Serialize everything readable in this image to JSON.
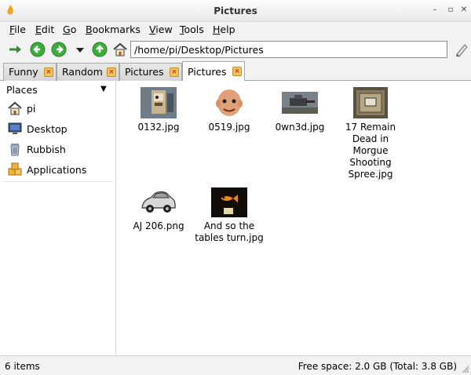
{
  "window": {
    "title": "Pictures"
  },
  "menu": [
    "File",
    "Edit",
    "Go",
    "Bookmarks",
    "View",
    "Tools",
    "Help"
  ],
  "toolbar": {
    "address": "/home/pi/Desktop/Pictures"
  },
  "tabs": [
    {
      "label": "Funny",
      "active": false
    },
    {
      "label": "Random",
      "active": false
    },
    {
      "label": "Pictures",
      "active": false
    },
    {
      "label": "Pictures",
      "active": true
    }
  ],
  "sidebar": {
    "header": "Places",
    "items": [
      {
        "label": "pi",
        "icon": "home-icon"
      },
      {
        "label": "Desktop",
        "icon": "desktop-icon"
      },
      {
        "label": "Rubbish",
        "icon": "trash-icon"
      },
      {
        "label": "Applications",
        "icon": "applications-icon"
      }
    ]
  },
  "files": [
    {
      "name": "0132.jpg",
      "thumb": "robot-photo"
    },
    {
      "name": "0519.jpg",
      "thumb": "bald-face-photo"
    },
    {
      "name": "0wn3d.jpg",
      "thumb": "tank-photo"
    },
    {
      "name": "17 Remain Dead in Morgue Shooting Spree.jpg",
      "thumb": "drawer-photo"
    },
    {
      "name": "AJ 206.png",
      "thumb": "car-clipart"
    },
    {
      "name": "And so the tables turn.jpg",
      "thumb": "fish-photo"
    }
  ],
  "status": {
    "item_count": "6 items",
    "free_space": "Free space: 2.0 GB (Total: 3.8 GB)"
  },
  "colors": {
    "go_green": "#3cae3c",
    "tab_close": "#f7c35a"
  }
}
